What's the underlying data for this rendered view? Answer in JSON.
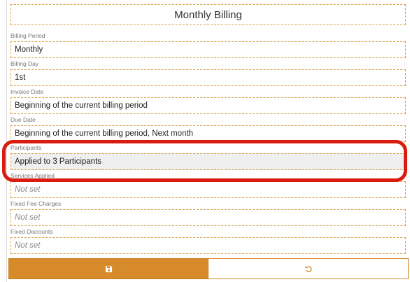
{
  "title": "Monthly Billing",
  "fields": [
    {
      "label": "Billing Period",
      "value": "Monthly"
    },
    {
      "label": "Billing Day",
      "value": "1st"
    },
    {
      "label": "Invoice Date",
      "value": "Beginning of the current billing period"
    },
    {
      "label": "Due Date",
      "value": "Beginning of the current billing period, Next month"
    },
    {
      "label": "Participants",
      "value": "Applied to 3 Participants"
    },
    {
      "label": "Services Applied",
      "value": "Not set"
    },
    {
      "label": "Fixed Fee Charges",
      "value": "Not set"
    },
    {
      "label": "Fixed Discounts",
      "value": "Not set"
    }
  ],
  "actions": {
    "save_icon": "save-icon",
    "revert_icon": "undo-icon"
  },
  "colors": {
    "accent": "#d68a2a",
    "highlight": "#d91c0f"
  }
}
